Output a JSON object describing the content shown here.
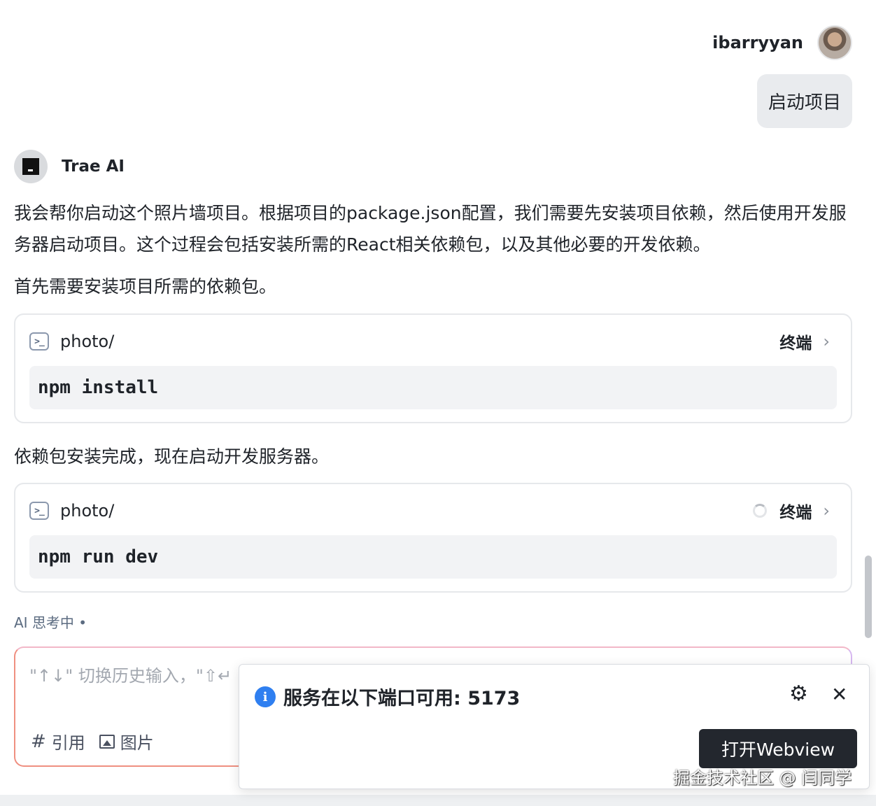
{
  "user": {
    "name": "ibarryyan",
    "message": "启动项目"
  },
  "ai": {
    "name": "Trae AI",
    "paragraphs": [
      "我会帮你启动这个照片墙项目。根据项目的package.json配置，我们需要先安装项目依赖，然后使用开发服务器启动项目。这个过程会包括安装所需的React相关依赖包，以及其他必要的开发依赖。",
      "首先需要安装项目所需的依赖包。",
      "依赖包安装完成，现在启动开发服务器。"
    ],
    "cards": [
      {
        "path": "photo/",
        "label": "终端",
        "command": "npm install",
        "running": false
      },
      {
        "path": "photo/",
        "label": "终端",
        "command": "npm run dev",
        "running": true
      }
    ],
    "thinking": "AI 思考中 •"
  },
  "input": {
    "placeholder": "\"↑↓\" 切换历史输入，\"⇧↵",
    "tools": {
      "quote": "引用",
      "image": "图片"
    }
  },
  "notification": {
    "message": "服务在以下端口可用: 5173",
    "button": "打开Webview"
  },
  "watermark": "掘金技术社区 @ 闫同学",
  "colors": {
    "accent_info": "#2f7ff0",
    "button_dark": "#23272e"
  }
}
